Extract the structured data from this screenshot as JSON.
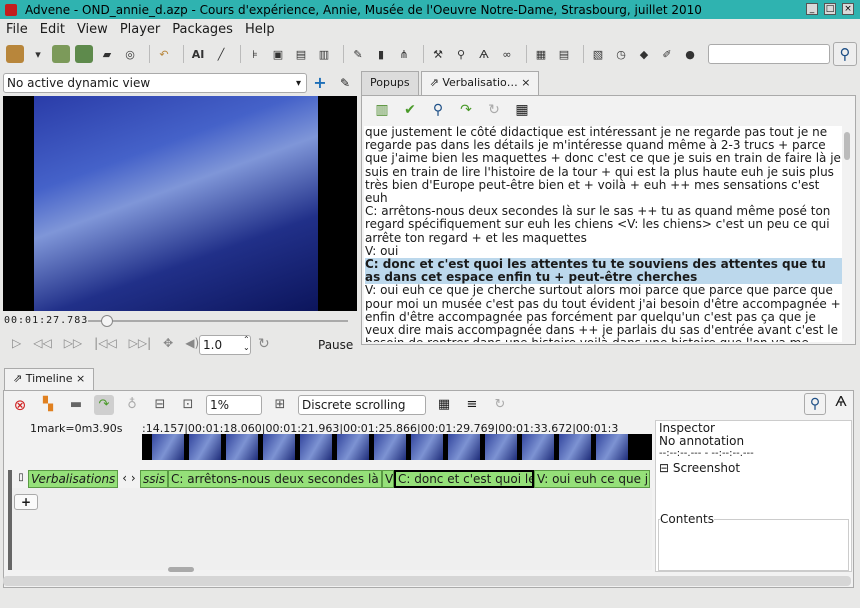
{
  "window": {
    "title": "Advene - OND_annie_d.azp - Cours d'expérience, Annie, Musée de l'Oeuvre Notre-Dame, Strasbourg, juillet 2010"
  },
  "menu": [
    "File",
    "Edit",
    "View",
    "Player",
    "Packages",
    "Help"
  ],
  "dynamic_view": {
    "value": "No active dynamic view"
  },
  "player": {
    "timecode": "00:01:27.783",
    "rate": "1.0",
    "status": "Pause",
    "position_fraction": 0.05
  },
  "tabs": [
    {
      "label": "Popups"
    },
    {
      "label": "Verbalisatio…"
    }
  ],
  "transcript": {
    "before": "que justement le côté didactique est intéressant je ne regarde pas tout je ne regarde pas dans les détails je m'intéresse quand même à 2-3 trucs + parce que j'aime bien les maquettes + donc c'est ce que je suis en train de faire là je suis en train de lire l'histoire de la tour + qui est la plus haute euh je suis plus très bien d'Europe peut-être bien et + voilà + euh ++ mes sensations c'est euh",
    "c1": "C: arrêtons-nous deux secondes là sur le sas ++ tu as quand même posé ton regard spécifiquement sur euh les chiens <V: les chiens> c'est un peu ce qui arrête ton regard + et les maquettes",
    "v1": "V: oui",
    "highlight": "C: donc et c'est quoi les attentes tu te souviens des attentes que tu as dans cet espace enfin tu + peut-être cherches",
    "after": "V: oui euh ce que je cherche surtout alors moi parce que parce que parce que pour moi un musée c'est pas du tout évident j'ai besoin d'être accompagnée + enfin d'être accompagnée pas forcément par quelqu'un c'est pas ça que je veux dire mais accompagnée dans ++ je parlais du sas d'entrée avant c'est le besoin de rentrer dans une histoire voilà dans une histoire que l'on va me proposer + là a fortiori des statues euh je ne suis pas quelqu'un qui aie des grandes notions d'histoire pour des raisons diverses et"
  },
  "timeline": {
    "tab_label": "Timeline",
    "zoom": "1%",
    "scrolling": "Discrete scrolling",
    "mark_label": "1mark=0m3.90s",
    "ruler": ":14.157|00:01:18.060|00:01:21.963|00:01:25.866|00:01:29.769|00:01:33.672|00:01:3",
    "annotation_type": "Verbalisations",
    "annotations": [
      {
        "text": "ssis"
      },
      {
        "text": "C: arrêtons-nous deux secondes là"
      },
      {
        "text": "V"
      },
      {
        "text": "C: donc et c'est quoi le"
      },
      {
        "text": "V: oui euh ce que j"
      }
    ]
  },
  "inspector": {
    "title": "Inspector",
    "annotation": "No annotation",
    "times": "--:--:--.--- - --:--:--.---",
    "screenshot": "Screenshot",
    "contents": "Contents"
  }
}
